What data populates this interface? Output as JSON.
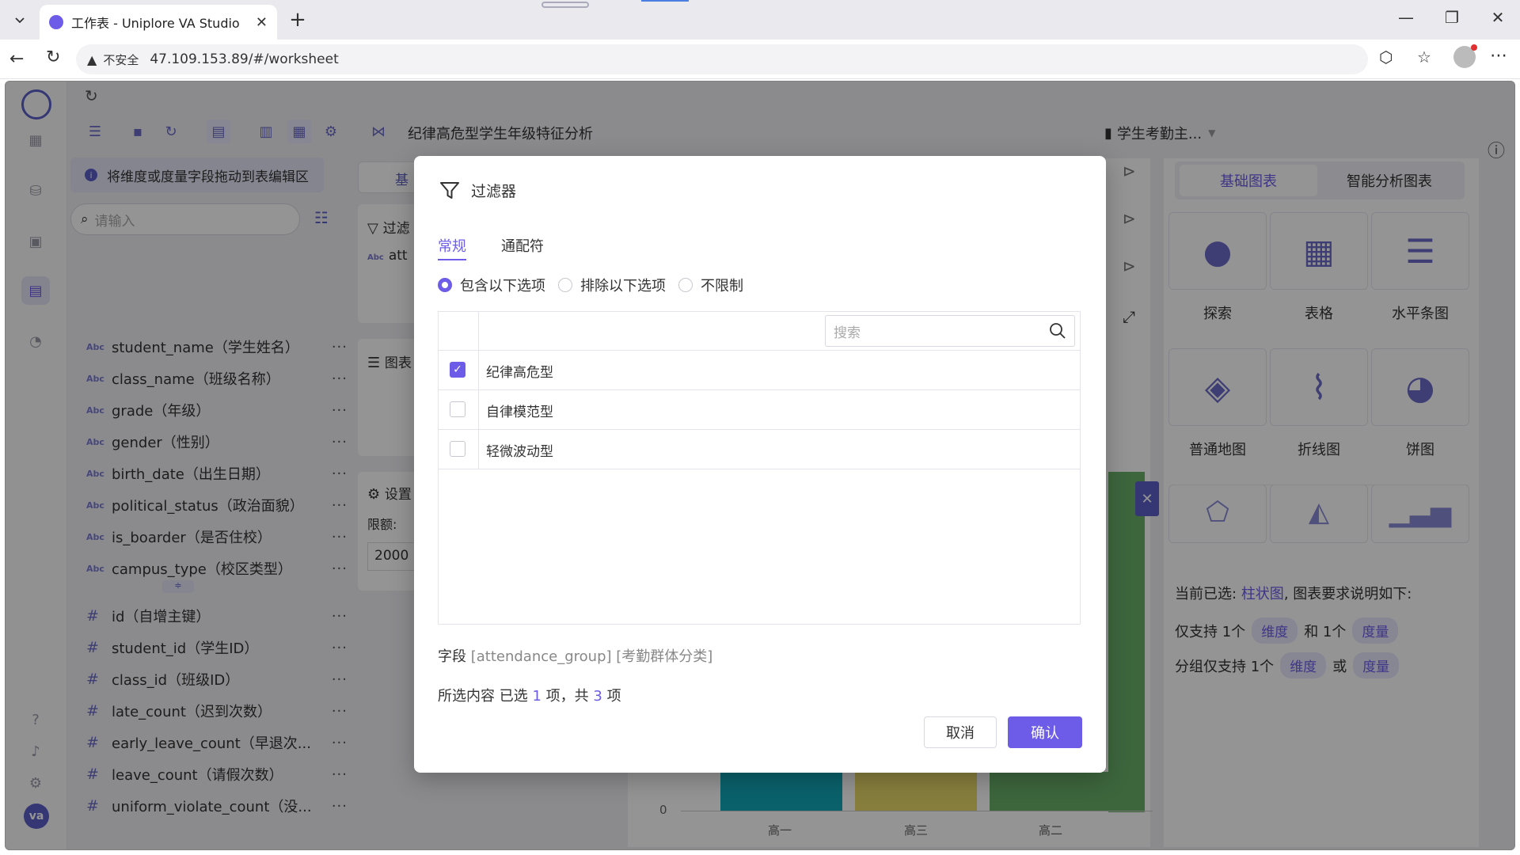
{
  "browser": {
    "tab_title": "工作表 - Uniplore VA Studio",
    "new_tab": "+",
    "insecure_label": "不安全",
    "url": "47.109.153.89/#/worksheet"
  },
  "app": {
    "refresh": "↻",
    "worksheet_title": "纪律高危型学生年级特征分析",
    "dataset_name": "学生考勤主...",
    "rail_avatar": "va"
  },
  "fields": {
    "drag_hint": "将维度或度量字段拖动到表编辑区",
    "search_placeholder": "请输入",
    "dimensions": [
      {
        "type": "Abc",
        "label": "student_name（学生姓名）"
      },
      {
        "type": "Abc",
        "label": "class_name（班级名称）"
      },
      {
        "type": "Abc",
        "label": "grade（年级）"
      },
      {
        "type": "Abc",
        "label": "gender（性别）"
      },
      {
        "type": "Abc",
        "label": "birth_date（出生日期）"
      },
      {
        "type": "Abc",
        "label": "political_status（政治面貌）"
      },
      {
        "type": "Abc",
        "label": "is_boarder（是否住校）"
      },
      {
        "type": "Abc",
        "label": "campus_type（校区类型）"
      }
    ],
    "measures": [
      {
        "type": "#",
        "label": "id（自增主键）"
      },
      {
        "type": "#",
        "label": "student_id（学生ID）"
      },
      {
        "type": "#",
        "label": "class_id（班级ID）"
      },
      {
        "type": "#",
        "label": "late_count（迟到次数）"
      },
      {
        "type": "#",
        "label": "early_leave_count（早退次..."
      },
      {
        "type": "#",
        "label": "leave_count（请假次数）"
      },
      {
        "type": "#",
        "label": "uniform_violate_count（没..."
      }
    ],
    "more": "···"
  },
  "middle": {
    "tab_basic": "基",
    "filter_label": "过滤",
    "filter_field": "att",
    "chart_label": "图表",
    "settings_label": "设置",
    "limit_label": "限额:",
    "limit_value": "2000"
  },
  "chart": {
    "y_zero": "0",
    "categories": [
      "高一",
      "高三",
      "高二"
    ]
  },
  "right": {
    "tab_basic": "基础图表",
    "tab_smart": "智能分析图表",
    "tiles": [
      {
        "label": "探索",
        "icon": "planet-icon"
      },
      {
        "label": "表格",
        "icon": "table-icon"
      },
      {
        "label": "水平条图",
        "icon": "horizontal-bar-icon"
      },
      {
        "label": "普通地图",
        "icon": "map-icon"
      },
      {
        "label": "折线图",
        "icon": "line-chart-icon"
      },
      {
        "label": "饼图",
        "icon": "pie-icon"
      }
    ],
    "current_prefix": "当前已选:",
    "current_chart": "柱状图",
    "current_suffix": ", 图表要求说明如下:",
    "req1_prefix": "仅支持 1个",
    "req1_dim": "维度",
    "req1_and": "和 1个",
    "req1_measure": "度量",
    "req2_prefix": "分组仅支持 1个",
    "req2_dim": "维度",
    "req2_or": "或",
    "req2_measure": "度量"
  },
  "dialog": {
    "title": "过滤器",
    "tab_general": "常规",
    "tab_wildcard": "通配符",
    "radio_include": "包含以下选项",
    "radio_exclude": "排除以下选项",
    "radio_unlimited": "不限制",
    "search_placeholder": "搜索",
    "options": [
      {
        "label": "纪律高危型",
        "checked": true
      },
      {
        "label": "自律模范型",
        "checked": false
      },
      {
        "label": "轻微波动型",
        "checked": false
      }
    ],
    "field_prefix": "字段",
    "field_name": "[attendance_group]",
    "field_alias": "[考勤群体分类]",
    "selected_prefix": "所选内容",
    "selected_text_a": "已选",
    "selected_count": "1",
    "selected_text_b": "项，共",
    "total_count": "3",
    "selected_text_c": "项",
    "cancel": "取消",
    "confirm": "确认"
  },
  "colors": {
    "accent": "#6c5ce7",
    "bar_teal": "#12a8b8",
    "bar_yellow": "#e8d96a",
    "bar_green": "#6ab06a"
  }
}
